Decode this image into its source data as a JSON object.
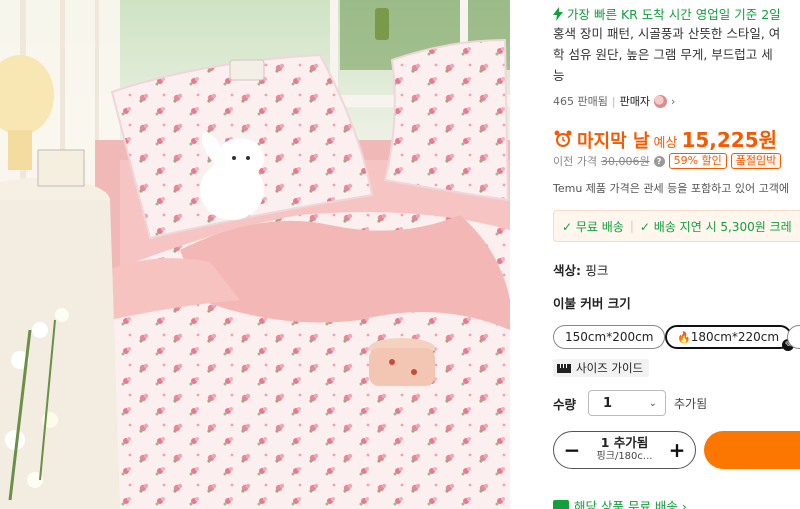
{
  "photo": {
    "alt_name": "pink floral bedding product photo"
  },
  "info": {
    "flash_text": "가장 빠른 KR 도착 시간 영업일 기준 2일",
    "desc_line1": "홍색 장미 패턴, 시골풍과 산뜻한 스타일, 여",
    "desc_line2": "학 섬유 원단, 높은 그램 무게, 부드럽고 세",
    "desc_line3": "능",
    "sold": "465 판매됨",
    "seller_label": "판매자",
    "seller_chevron": "›"
  },
  "pricing": {
    "deal_label": "마지막 날",
    "est_label": "예상",
    "price": "15,225원",
    "prev_label": "이전 가격",
    "prev_price": "30,006원",
    "help": "?",
    "discount": "59% 할인",
    "best_tag": "품절임박",
    "note": "Temu 제품 가격은 관세 등을 포함하고 있어 고객에"
  },
  "shipping": {
    "free": "✓ 무료 배송",
    "divider": "|",
    "delay": "✓ 배송 지연 시 5,300원 크레"
  },
  "options": {
    "color_label": "색상:",
    "color_value": "핑크",
    "size_label": "이불 커버 크기",
    "sizes": [
      "150cm*200cm",
      "180cm*220cm"
    ],
    "size_guide": "사이즈 가이드"
  },
  "quantity": {
    "label": "수량",
    "value": "1",
    "extra": "추가됨"
  },
  "stepper": {
    "minus": "−",
    "plus": "+",
    "count_text": "1 추가됨",
    "variant_text": "핑크/180c..."
  },
  "promo": {
    "text": "해당 상품 무료 배송 ›"
  },
  "colors": {
    "accent_orange": "#f55a00",
    "cart_orange": "#fb7701",
    "green": "#12a03c"
  }
}
